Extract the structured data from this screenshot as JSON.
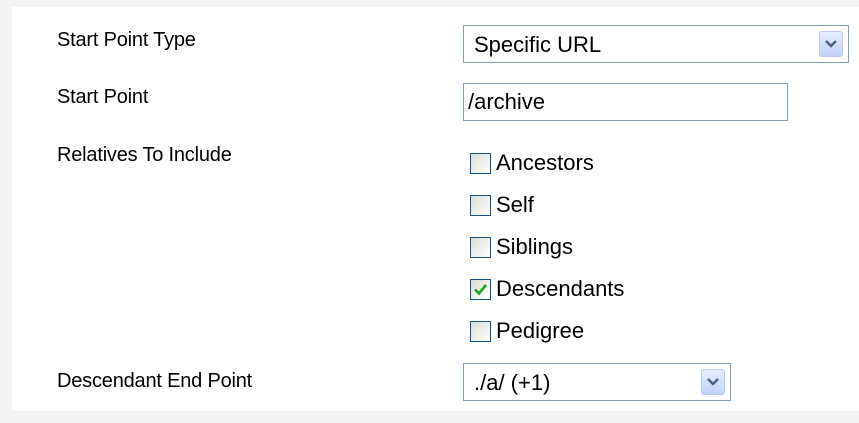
{
  "form": {
    "start_point_type": {
      "label": "Start Point Type",
      "selected": "Specific URL"
    },
    "start_point": {
      "label": "Start Point",
      "value": "/archive"
    },
    "relatives": {
      "label": "Relatives To Include",
      "options": [
        {
          "label": "Ancestors",
          "checked": false
        },
        {
          "label": "Self",
          "checked": false
        },
        {
          "label": "Siblings",
          "checked": false
        },
        {
          "label": "Descendants",
          "checked": true
        },
        {
          "label": "Pedigree",
          "checked": false
        }
      ]
    },
    "descendant_end_point": {
      "label": "Descendant End Point",
      "selected": "./a/ (+1)"
    }
  },
  "colors": {
    "checkmark": "#21a121",
    "dropdown_arrow": "#4d6185",
    "field_border": "#7f9db9"
  },
  "icons": {
    "dropdown": "chevron-down-icon",
    "checkmark": "check-icon"
  }
}
